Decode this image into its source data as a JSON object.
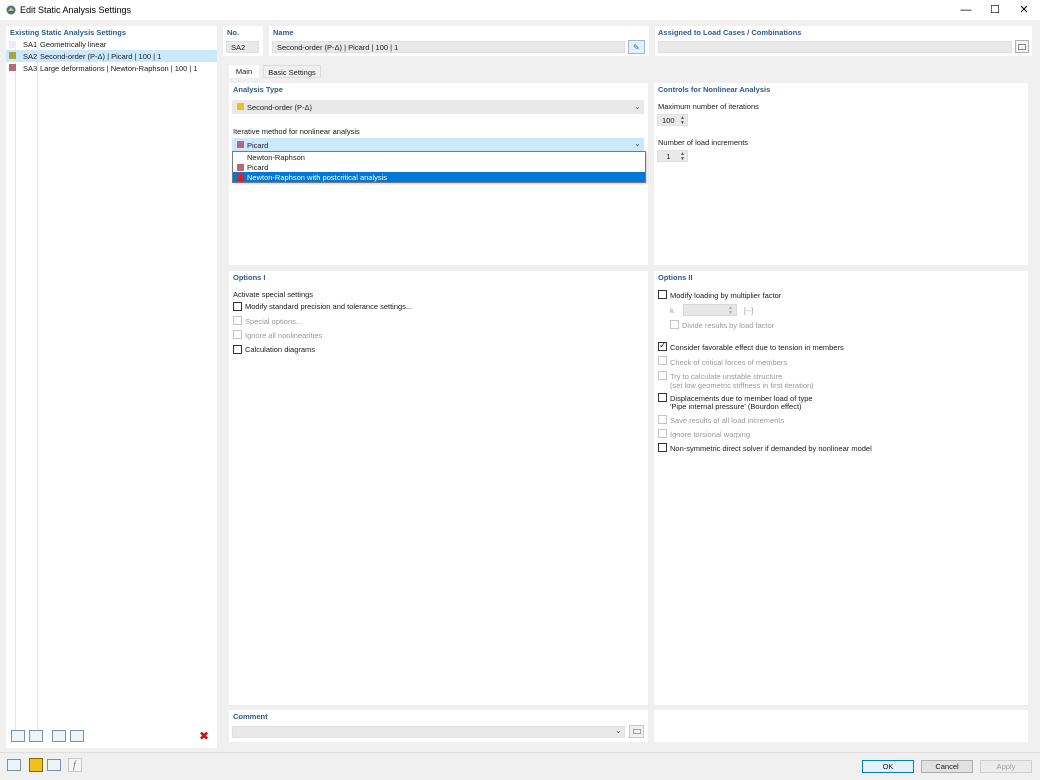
{
  "window": {
    "title": "Edit Static Analysis Settings",
    "minimize_glyph": "—",
    "maximize_glyph": "☐",
    "close_glyph": "✕"
  },
  "left_panel": {
    "header": "Existing Static Analysis Settings",
    "items": [
      {
        "id": "SA1",
        "label": "Geometrically linear",
        "color": "#e4f0f8"
      },
      {
        "id": "SA2",
        "label": "Second-order (P-Δ) | Picard | 100 | 1",
        "color": "#a6a644"
      },
      {
        "id": "SA3",
        "label": "Large deformations | Newton-Raphson | 100 | 1",
        "color": "#b46a7a"
      }
    ],
    "selected_index": 1
  },
  "top": {
    "no_label": "No.",
    "no_value": "SA2",
    "name_label": "Name",
    "name_value": "Second-order (P-Δ) | Picard | 100 | 1",
    "assigned_label": "Assigned to Load Cases / Combinations",
    "assigned_value": ""
  },
  "tabs": [
    {
      "label": "Main",
      "active": true
    },
    {
      "label": "Basic Settings",
      "active": false
    }
  ],
  "analysis_type": {
    "header": "Analysis Type",
    "selected": "Second-order (P-Δ)",
    "selected_color": "#f0c020",
    "iterative_label": "Iterative method for nonlinear analysis",
    "iterative_selected": "Picard",
    "iterative_selected_color": "#b46a7a",
    "options": [
      {
        "label": "Newton-Raphson",
        "color": ""
      },
      {
        "label": "Picard",
        "color": "#b46a7a"
      },
      {
        "label": "Newton-Raphson with postcritical analysis",
        "color": "#e02020"
      }
    ],
    "highlighted_option_index": 2
  },
  "controls": {
    "header": "Controls for Nonlinear Analysis",
    "max_iter_label": "Maximum number of iterations",
    "max_iter_value": "100",
    "load_incr_label": "Number of load increments",
    "load_incr_value": "1"
  },
  "options1": {
    "header": "Options I",
    "sub_label": "Activate special settings",
    "items": [
      {
        "label": "Modify standard precision and tolerance settings...",
        "checked": false,
        "enabled": true
      },
      {
        "label": "Special options...",
        "checked": false,
        "enabled": false
      },
      {
        "label": "Ignore all nonlinearities",
        "checked": false,
        "enabled": false
      },
      {
        "label": "Calculation diagrams",
        "checked": false,
        "enabled": true
      }
    ]
  },
  "options2": {
    "header": "Options II",
    "modify_loading": "Modify loading by multiplier factor",
    "k_label": "k",
    "k_unit": "[--]",
    "divide_results": "Divide results by load factor",
    "favorable": "Consider favorable effect due to tension in members",
    "critical_forces": "Check of critical forces of members",
    "unstable_line1": "Try to calculate unstable structure",
    "unstable_line2": "(set low geometric stiffness in first iteration)",
    "displacement_line1": "Displacements due to member load of type",
    "displacement_line2": "'Pipe internal pressure' (Bourdon effect)",
    "save_results": "Save results of all load increments",
    "ignore_torsional": "Ignore torsional warping",
    "nonsymmetric": "Non-symmetric direct solver if demanded by nonlinear model"
  },
  "comment": {
    "label": "Comment",
    "value": ""
  },
  "footer": {
    "ok": "OK",
    "cancel": "Cancel",
    "apply": "Apply"
  },
  "icons": {
    "delete_glyph": "✖",
    "function_glyph": "f"
  }
}
